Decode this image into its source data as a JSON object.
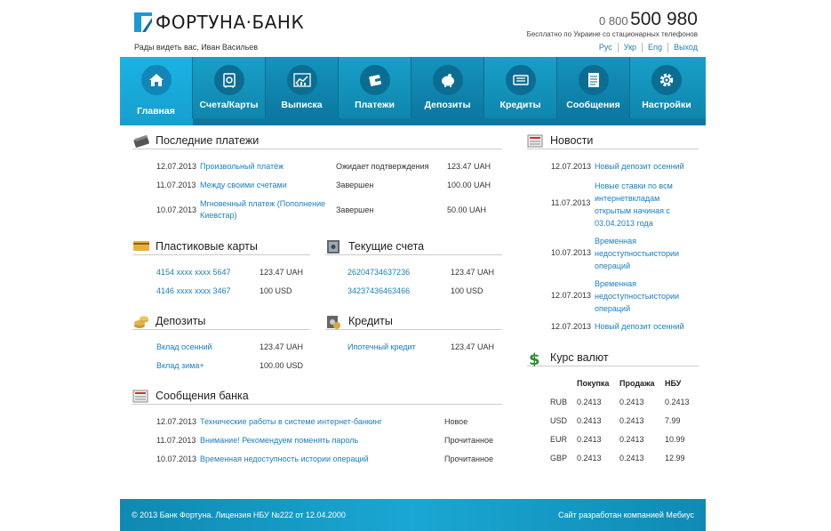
{
  "header": {
    "logo_text": "ФОРТУНА·БАНК",
    "greeting": "Рады видеть вас, Иван Васильев",
    "phone_prefix": "0 800",
    "phone_number": "500 980",
    "phone_note": "Бесплатно по Украине со стационарных телефонов",
    "langs": [
      "Рус",
      "Укр",
      "Eng",
      "Выход"
    ]
  },
  "nav": [
    {
      "label": "Главная",
      "icon": "house-icon",
      "active": true
    },
    {
      "label": "Счета/Карты",
      "icon": "safe-icon"
    },
    {
      "label": "Выписка",
      "icon": "chart-icon"
    },
    {
      "label": "Платежи",
      "icon": "wallet-icon"
    },
    {
      "label": "Депозиты",
      "icon": "piggy-bank-icon"
    },
    {
      "label": "Кредиты",
      "icon": "cash-icon"
    },
    {
      "label": "Сообщения",
      "icon": "document-icon"
    },
    {
      "label": "Настройки",
      "icon": "gear-icon"
    }
  ],
  "payments": {
    "title": "Последние платежи",
    "rows": [
      {
        "date": "12.07.2013",
        "name": "Произвольный платёж",
        "status": "Ожидает подтверждения",
        "amount": "123.47 UAH"
      },
      {
        "date": "11.07.2013",
        "name": "Между своими счетами",
        "status": "Завершен",
        "amount": "100.00 UAH"
      },
      {
        "date": "10.07.2013",
        "name_line1": "Мгновенный платеж (Пополнение",
        "name_line2": "Киевстар)",
        "status": "Завершен",
        "amount": "50.00 UAH"
      }
    ]
  },
  "cards": {
    "title": "Пластиковые карты",
    "rows": [
      {
        "name": "4154 xxxx xxxx 5647",
        "amount": "123.47 UAH"
      },
      {
        "name": "4146 xxxx xxxx 3467",
        "amount": "100 USD"
      }
    ]
  },
  "accounts": {
    "title": "Текущие счета",
    "rows": [
      {
        "name": "26204734637236",
        "amount": "123.47 UAH"
      },
      {
        "name": "34237436463466",
        "amount": "100 USD"
      }
    ]
  },
  "deposits": {
    "title": "Депозиты",
    "rows": [
      {
        "name": "Вклад осенний",
        "amount": "123.47 UAH"
      },
      {
        "name": "Вклад зима+",
        "amount": "100.00 USD"
      }
    ]
  },
  "credits": {
    "title": "Кредиты",
    "rows": [
      {
        "name": "Ипотечный кредит",
        "amount": "123.47 UAH"
      }
    ]
  },
  "messages": {
    "title": "Сообщения банка",
    "rows": [
      {
        "date": "12.07.2013",
        "name": "Технические работы в системе интернет-банкинг",
        "status": "Новое"
      },
      {
        "date": "11.07.2013",
        "name": "Внимание! Рекомендуем поменять пароль",
        "status": "Прочитанное"
      },
      {
        "date": "10.07.2013",
        "name": "Временная недоступность истории операций",
        "status": "Прочитанное"
      }
    ]
  },
  "news": {
    "title": "Новости",
    "rows": [
      {
        "date": "12.07.2013",
        "lines": [
          "Новый депозит осенний"
        ]
      },
      {
        "date": "11.07.2013",
        "lines": [
          "Новые ставки по всм",
          "интернетвкладам",
          "открытым начиная с",
          "03.04.2013 года"
        ]
      },
      {
        "date": "10.07.2013",
        "lines": [
          "Временная",
          "недоступностьистории",
          "операций"
        ]
      },
      {
        "date": "12.07.2013",
        "lines": [
          "Временная",
          "недоступностьистории",
          "операций"
        ]
      },
      {
        "date": "12.07.2013",
        "lines": [
          "Новый депозит осенний"
        ]
      }
    ]
  },
  "rates": {
    "title": "Курс валют",
    "headers": [
      "",
      "Покупка",
      "Продажа",
      "НБУ"
    ],
    "rows": [
      [
        "RUB",
        "0.2413",
        "0.2413",
        "0.2413"
      ],
      [
        "USD",
        "0.2413",
        "0.2413",
        "7.99"
      ],
      [
        "EUR",
        "0.2413",
        "0.2413",
        "10.99"
      ],
      [
        "GBP",
        "0.2413",
        "0.2413",
        "12.99"
      ]
    ]
  },
  "footer": {
    "left": "© 2013 Банк Фортуна. Лицензия НБУ №222 от 12.04.2000",
    "right": "Сайт разработан компанией Мебиус"
  },
  "colors": {
    "accent": "#1a7fc1",
    "nav": "#1593bd",
    "nav_active": "#1ab2e2"
  }
}
